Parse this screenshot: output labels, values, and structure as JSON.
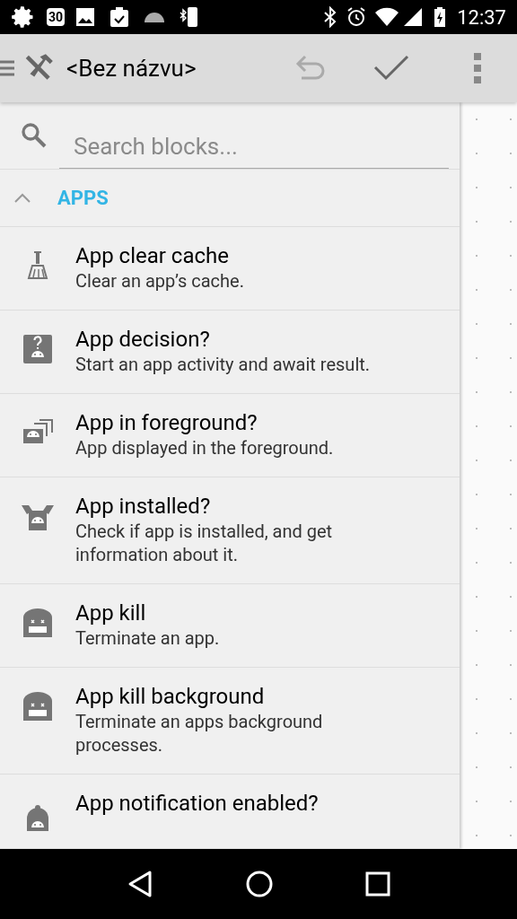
{
  "status_bar": {
    "calendar_day": "30",
    "time": "12:37"
  },
  "toolbar": {
    "title": "<Bez názvu>"
  },
  "search": {
    "placeholder": "Search blocks..."
  },
  "category": {
    "label": "APPS",
    "expanded": true
  },
  "blocks": [
    {
      "kind": "broom",
      "title": "App clear cache",
      "description": "Clear an app’s cache."
    },
    {
      "kind": "question",
      "title": "App decision?",
      "description": "Start an app activity and await result."
    },
    {
      "kind": "stack",
      "title": "App in foreground?",
      "description": "App displayed in the foreground."
    },
    {
      "kind": "box",
      "title": "App installed?",
      "description": "Check if app is installed, and get information about it."
    },
    {
      "kind": "tomb",
      "title": "App kill",
      "description": "Terminate an app."
    },
    {
      "kind": "tomb",
      "title": "App kill background",
      "description": "Terminate an apps background processes."
    },
    {
      "kind": "bell",
      "title": "App notification enabled?"
    }
  ]
}
